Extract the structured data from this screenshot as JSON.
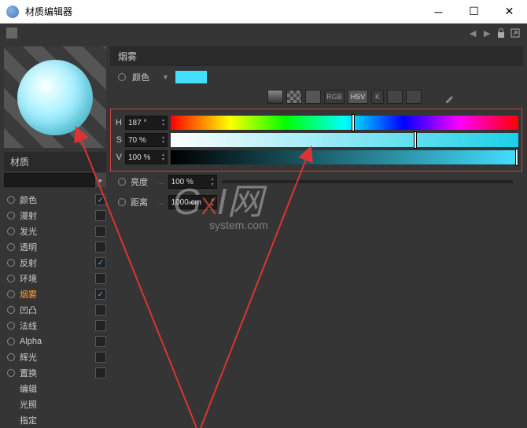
{
  "window": {
    "title": "材质编辑器"
  },
  "material_label": "材质",
  "section": "烟雾",
  "color": {
    "label": "颜色",
    "swatch": "#44dfff"
  },
  "toolbar": {
    "rgb": "RGB",
    "hsv": "HSV",
    "k": "K"
  },
  "hsv": {
    "h": {
      "label": "H",
      "value": "187 °",
      "pos": 52
    },
    "s": {
      "label": "S",
      "value": "70 %",
      "pos": 70
    },
    "v": {
      "label": "V",
      "value": "100 %",
      "pos": 100
    }
  },
  "brightness": {
    "label": "亮度",
    "value": "100 %"
  },
  "distance": {
    "label": "距离",
    "value": "1000 cm"
  },
  "channels": [
    {
      "label": "颜色",
      "checked": true,
      "active": false
    },
    {
      "label": "漫射",
      "checked": false,
      "active": false
    },
    {
      "label": "发光",
      "checked": false,
      "active": false
    },
    {
      "label": "透明",
      "checked": false,
      "active": false
    },
    {
      "label": "反射",
      "checked": true,
      "active": false
    },
    {
      "label": "环境",
      "checked": false,
      "active": false
    },
    {
      "label": "烟雾",
      "checked": true,
      "active": true
    },
    {
      "label": "凹凸",
      "checked": false,
      "active": false
    },
    {
      "label": "法线",
      "checked": false,
      "active": false
    },
    {
      "label": "Alpha",
      "checked": false,
      "active": false
    },
    {
      "label": "辉光",
      "checked": false,
      "active": false
    },
    {
      "label": "置换",
      "checked": false,
      "active": false
    }
  ],
  "extra_items": [
    "编辑",
    "光照",
    "指定"
  ],
  "watermark": {
    "g": "G",
    "x": "X",
    "i": "I",
    "net": "网",
    "sub": "system.com"
  }
}
